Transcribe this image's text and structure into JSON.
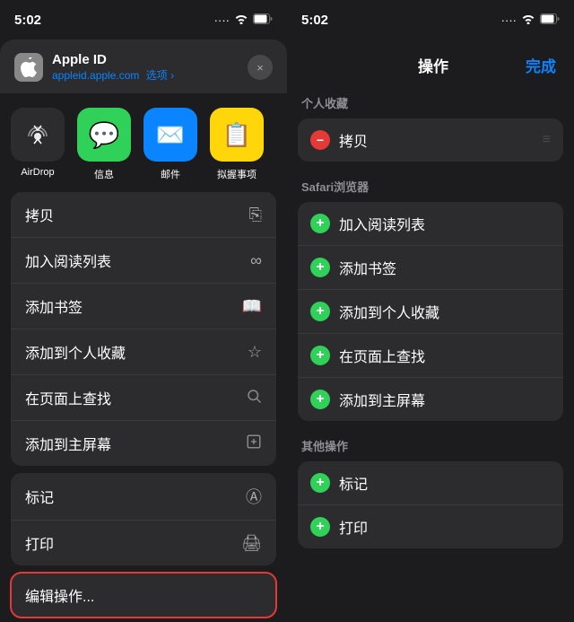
{
  "left": {
    "status_time": "5:02",
    "status_icons": [
      "···",
      "WiFi",
      "Battery"
    ],
    "header": {
      "title": "Apple ID",
      "subtitle": "appleid.apple.com",
      "option": "选项 ›",
      "close_label": "×"
    },
    "share_icons": [
      {
        "label": "AirDrop",
        "icon": "📡",
        "style": "icon-airdrop"
      },
      {
        "label": "信息",
        "icon": "💬",
        "style": "icon-messages"
      },
      {
        "label": "邮件",
        "icon": "✉️",
        "style": "icon-mail"
      },
      {
        "label": "拟握事项",
        "icon": "📋",
        "style": "icon-notes"
      }
    ],
    "menu_sections": [
      {
        "items": [
          {
            "label": "拷贝",
            "icon": "copy"
          },
          {
            "label": "加入阅读列表",
            "icon": "glasses"
          },
          {
            "label": "添加书签",
            "icon": "book"
          },
          {
            "label": "添加到个人收藏",
            "icon": "star"
          },
          {
            "label": "在页面上查找",
            "icon": "search"
          },
          {
            "label": "添加到主屏幕",
            "icon": "add-square"
          }
        ]
      },
      {
        "items": [
          {
            "label": "标记",
            "icon": "compass"
          },
          {
            "label": "打印",
            "icon": "print"
          }
        ]
      },
      {
        "items": [
          {
            "label": "编辑操作...",
            "icon": "",
            "highlighted": true
          }
        ]
      }
    ]
  },
  "right": {
    "status_time": "5:02",
    "header": {
      "title": "操作",
      "done": "完成"
    },
    "sections": [
      {
        "header": "个人收藏",
        "items": [
          {
            "label": "拷贝",
            "type": "favorite"
          }
        ]
      },
      {
        "header": "Safari浏览器",
        "items": [
          {
            "label": "加入阅读列表",
            "type": "add"
          },
          {
            "label": "添加书签",
            "type": "add"
          },
          {
            "label": "添加到个人收藏",
            "type": "add"
          },
          {
            "label": "在页面上查找",
            "type": "add"
          },
          {
            "label": "添加到主屏幕",
            "type": "add"
          }
        ]
      },
      {
        "header": "其他操作",
        "items": [
          {
            "label": "标记",
            "type": "add"
          },
          {
            "label": "打印",
            "type": "add"
          }
        ]
      }
    ]
  }
}
